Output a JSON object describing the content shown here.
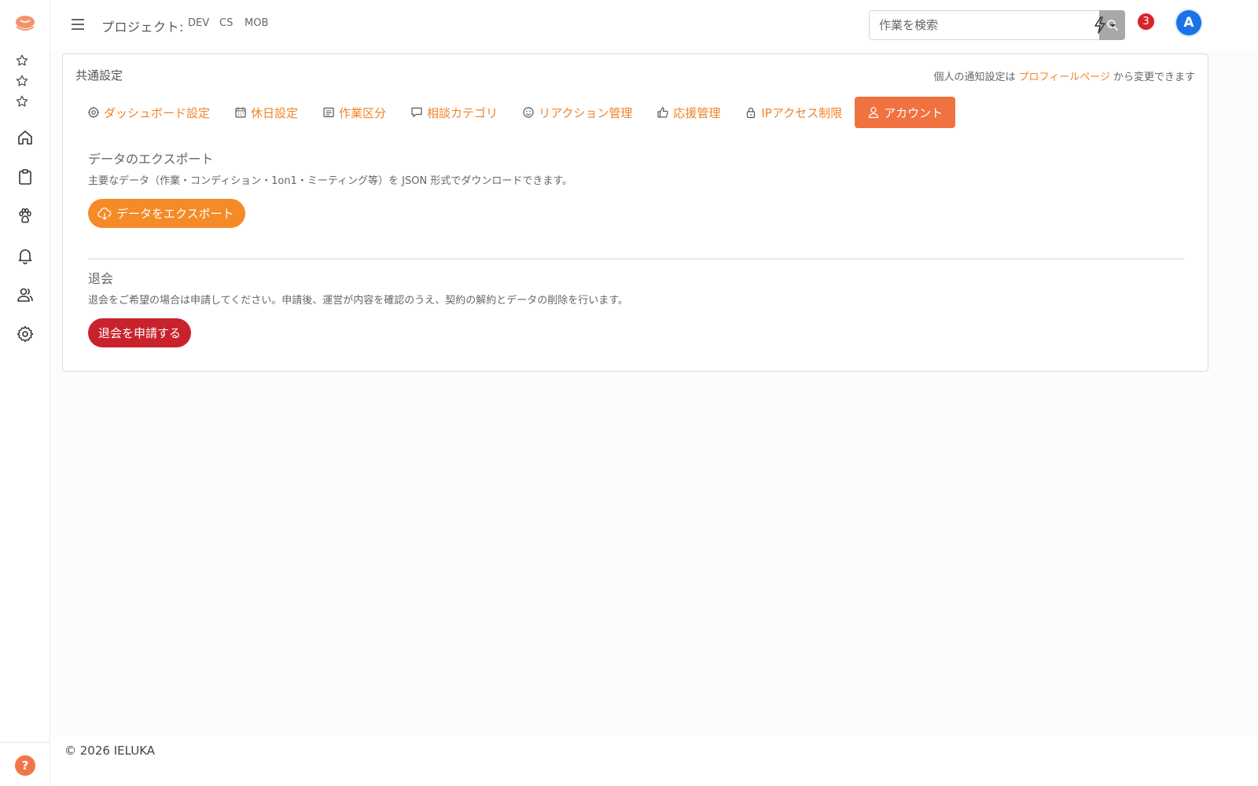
{
  "sidebar": {
    "logo": "chat-bubble-logo",
    "favorites": [
      "star-icon",
      "star-icon",
      "star-icon"
    ],
    "nav": [
      "home-icon",
      "clipboard-icon",
      "paw-icon",
      "bell-icon",
      "users-icon",
      "gear-icon"
    ],
    "help_label": "?"
  },
  "header": {
    "project_label": "プロジェクト:",
    "projects": [
      "DEV",
      "CS",
      "MOB"
    ],
    "search": {
      "placeholder": "作業を検索",
      "value": ""
    },
    "notification_count": "3",
    "avatar_initial": "A"
  },
  "settings": {
    "title": "共通設定",
    "notice": {
      "before": "個人の通知設定は",
      "link": "プロフィールページ",
      "after": "から変更できます"
    },
    "tabs": [
      {
        "label": "ダッシュボード設定",
        "icon": "gear-icon"
      },
      {
        "label": "休日設定",
        "icon": "calendar-icon"
      },
      {
        "label": "作業区分",
        "icon": "list-icon"
      },
      {
        "label": "相談カテゴリ",
        "icon": "chat-icon"
      },
      {
        "label": "リアクション管理",
        "icon": "smile-icon"
      },
      {
        "label": "応援管理",
        "icon": "thumbs-up-icon"
      },
      {
        "label": "IPアクセス制限",
        "icon": "lock-icon"
      },
      {
        "label": "アカウント",
        "icon": "person-icon",
        "active": true
      }
    ],
    "export": {
      "title": "データのエクスポート",
      "description": "主要なデータ（作業・コンディション・1on1・ミーティング等）を JSON 形式でダウンロードできます。",
      "button_label": "データをエクスポート"
    },
    "withdraw": {
      "title": "退会",
      "description": "退会をご希望の場合は申請してください。申請後、運営が内容を確認のうえ、契約の解約とデータの削除を行います。",
      "button_label": "退会を申請する"
    }
  },
  "footer": {
    "copyright": "© 2026 IELUKA"
  },
  "colors": {
    "accent": "#f0832a",
    "active_tab": "#f07240",
    "export_button": "#f58a28",
    "danger": "#c8232c",
    "notification_badge": "#d8232a",
    "avatar": "#1a73e8"
  }
}
